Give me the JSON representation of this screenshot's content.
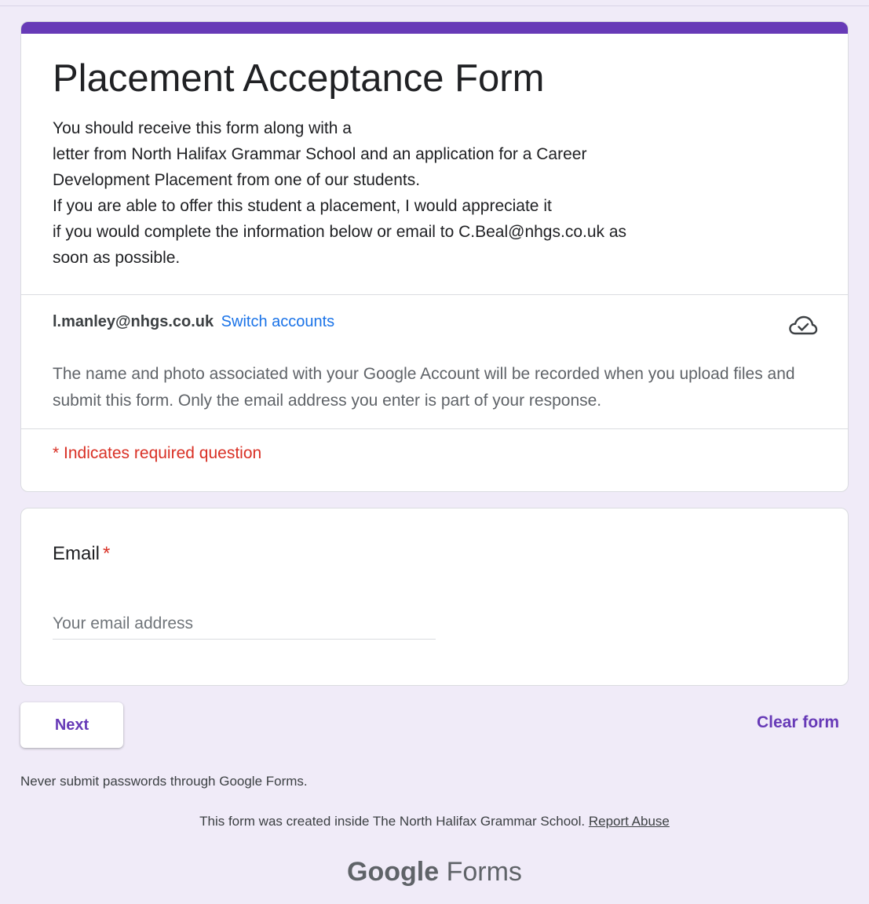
{
  "form": {
    "title": "Placement Acceptance Form",
    "description_lines": [
      "You should receive this form along with a",
      "letter from North Halifax Grammar School and an application for a Career",
      "Development Placement from one of our students.",
      "If you are able to offer this student a placement, I would appreciate it",
      "if you would complete the information below or email to C.Beal@nhgs.co.uk as",
      "soon as possible."
    ],
    "accent_color": "#673ab7"
  },
  "account": {
    "email": "l.manley@nhgs.co.uk",
    "switch_label": "Switch accounts",
    "cloud_icon": "cloud-check-icon",
    "notice": "The name and photo associated with your Google Account will be recorded when you upload files and submit this form. Only the email address you enter is part of your response."
  },
  "required_note": "* Indicates required question",
  "question": {
    "label": "Email",
    "required_marker": "*",
    "placeholder": "Your email address",
    "value": ""
  },
  "actions": {
    "next_label": "Next",
    "clear_label": "Clear form"
  },
  "footer": {
    "warning": "Never submit passwords through Google Forms.",
    "created_text": "This form was created inside The North Halifax Grammar School.",
    "report_label": "Report Abuse",
    "logo_google": "Google",
    "logo_forms": "Forms"
  }
}
